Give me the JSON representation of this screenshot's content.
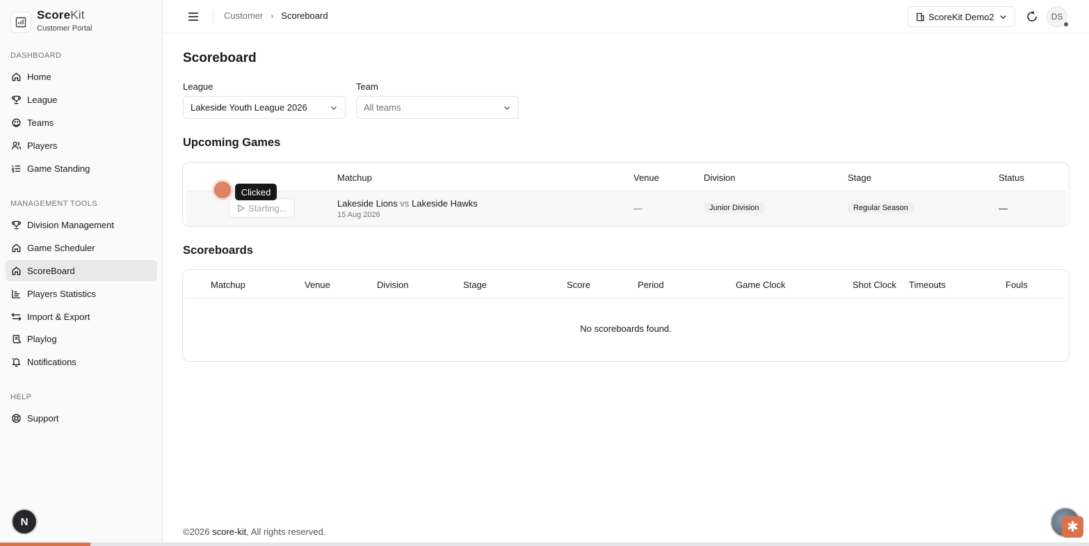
{
  "brand": {
    "name_bold": "Score",
    "name_light": "Kit",
    "subtitle": "Customer Portal"
  },
  "sidebar": {
    "sections": [
      {
        "title": "DASHBOARD",
        "items": [
          {
            "label": "Home",
            "icon": "home-icon"
          },
          {
            "label": "League",
            "icon": "trophy-icon"
          },
          {
            "label": "Teams",
            "icon": "teams-icon"
          },
          {
            "label": "Players",
            "icon": "users-icon"
          },
          {
            "label": "Game Standing",
            "icon": "list-ordered-icon"
          }
        ]
      },
      {
        "title": "MANAGEMENT TOOLS",
        "items": [
          {
            "label": "Division Management",
            "icon": "trophy-icon"
          },
          {
            "label": "Game Scheduler",
            "icon": "home-icon"
          },
          {
            "label": "ScoreBoard",
            "icon": "home-icon",
            "active": true
          },
          {
            "label": "Players Statistics",
            "icon": "bar-chart-icon"
          },
          {
            "label": "Import & Export",
            "icon": "swap-icon"
          },
          {
            "label": "Playlog",
            "icon": "scroll-icon"
          },
          {
            "label": "Notifications",
            "icon": "bell-icon"
          }
        ]
      },
      {
        "title": "HELP",
        "items": [
          {
            "label": "Support",
            "icon": "lifebuoy-icon"
          }
        ]
      }
    ],
    "bottom_badge": "N"
  },
  "header": {
    "breadcrumb": [
      "Customer",
      "Scoreboard"
    ],
    "org_switcher": "ScoreKit Demo2",
    "avatar_initials": "DS"
  },
  "main": {
    "title": "Scoreboard",
    "filters": {
      "league": {
        "label": "League",
        "value": "Lakeside Youth League 2026"
      },
      "team": {
        "label": "Team",
        "placeholder": "All teams"
      }
    },
    "upcoming": {
      "title": "Upcoming Games",
      "columns": [
        "Matchup",
        "Venue",
        "Division",
        "Stage",
        "Status"
      ],
      "rows": [
        {
          "action_label": "Starting...",
          "home": "Lakeside Lions",
          "vs": "vs",
          "away": "Lakeside Hawks",
          "date": "15 Aug 2026",
          "venue": "—",
          "division": "Junior Division",
          "stage": "Regular Season",
          "status": "—"
        }
      ]
    },
    "scoreboards": {
      "title": "Scoreboards",
      "columns": [
        "Matchup",
        "Venue",
        "Division",
        "Stage",
        "Score",
        "Period",
        "Game Clock",
        "Shot Clock",
        "Timeouts",
        "Fouls"
      ],
      "empty_text": "No scoreboards found."
    }
  },
  "overlay": {
    "tooltip": "Clicked"
  },
  "footer": {
    "prefix": "©2026 ",
    "brand": "score-kit",
    "suffix": ", All rights reserved."
  },
  "progress": {
    "fraction": 0.083
  },
  "colors": {
    "accent": "#d9714f",
    "active_bg": "#e9e9eb",
    "border": "#e4e4e7",
    "muted": "#71717a"
  }
}
